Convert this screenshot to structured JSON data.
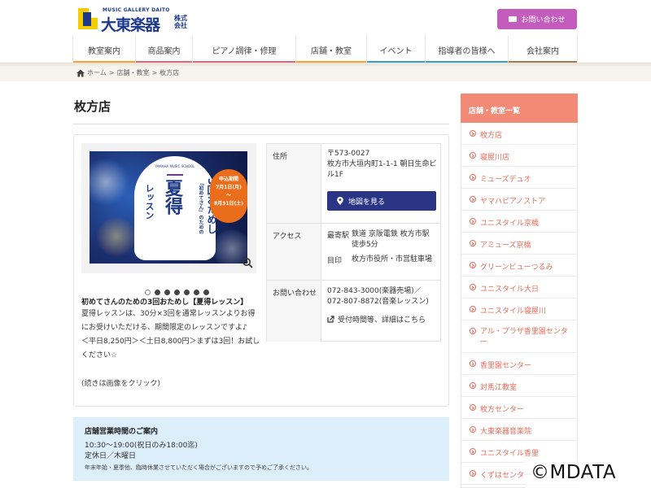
{
  "header": {
    "logo_sub": "MUSIC GALLERY DAITO",
    "logo_name": "大東楽器",
    "logo_corp": "株式会社",
    "contact_label": "お問い合わせ",
    "brand_color": "#1d3a8a",
    "contact_color": "#c45cbd"
  },
  "nav": {
    "items": [
      {
        "label": "教室案内",
        "color": "#f2a531"
      },
      {
        "label": "商品案内",
        "color": "#e8647d"
      },
      {
        "label": "ピアノ調律・修理",
        "color": "#e8647d"
      },
      {
        "label": "店舗・教室",
        "color": "#f2a531"
      },
      {
        "label": "イベント",
        "color": "#3aa0c8"
      },
      {
        "label": "指導者の皆様へ",
        "color": "#3aa0c8"
      },
      {
        "label": "会社案内",
        "color": "#a77a55"
      }
    ]
  },
  "breadcrumb": {
    "home": "ホーム",
    "sep": ">",
    "level1": "店舗・教室",
    "current": "枚方店"
  },
  "page_title": "枚方店",
  "slider": {
    "banner": {
      "school": "YAMAHA MUSIC SCHOOL",
      "line1": "「初めてさん」のための",
      "line2": "3回おためし",
      "line3": "夏得",
      "line4": "レッスン",
      "badge_top": "申込期間",
      "badge_from": "7月1日(月)",
      "badge_to": "8月31日(土)"
    },
    "dot_count": 7,
    "active_dot": 0
  },
  "caption": {
    "title": "初めてさんのための3回おためし【夏得レッスン】",
    "body": "夏得レッスンは、30分×3回を通常レッスンよりお得にお受けいただける、期間限定のレッスンですよ♪\n＜平日8,250円＞＜土日8,800円＞まずは3回！お試しください☆",
    "note": "(続きは画像をクリック)"
  },
  "info": {
    "address_label": "住所",
    "address_value": "〒573-0027\n枚方市大垣内町1-1-1 朝日生命ビル1F",
    "map_button": "地図を見る",
    "access_label": "アクセス",
    "access_sub1": "最寄駅",
    "access_val1": "鉄道 京阪電鉄 枚方市駅 徒歩5分",
    "access_sub2": "目印",
    "access_val2": "枚方市役所・市営駐車場",
    "contact_label": "お問い合わせ",
    "contact_value": "072-843-3000(楽器売場)／072-807-8872(音楽レッスン)",
    "contact_link": "受付時間等、詳細はこちら"
  },
  "hours": {
    "title": "店舗営業時間のご案内",
    "line1": "10:30〜19:00(祝日のみ18:00迄)",
    "line2": "定休日／木曜日",
    "note": "年末年始・夏季他、臨時休業させていただく場合がございますので予めご了承ください。"
  },
  "sidebar": {
    "title": "店舗・教室一覧",
    "accent": "#f38a78",
    "items": [
      "枚方店",
      "寝屋川店",
      "ミューズデュオ",
      "ヤマハピアノストア",
      "ユニスタイル京橋",
      "アミューズ京橋",
      "グリーンビューつるみ",
      "ユニスタイル大日",
      "ユニスタイル寝屋川",
      "アル・プラザ香里園センター",
      "香里園センター",
      "対馬江教室",
      "枚方センター",
      "大東楽器音楽院",
      "ユニスタイル香里",
      "くずはセンター"
    ]
  },
  "watermark": "©MDATA"
}
